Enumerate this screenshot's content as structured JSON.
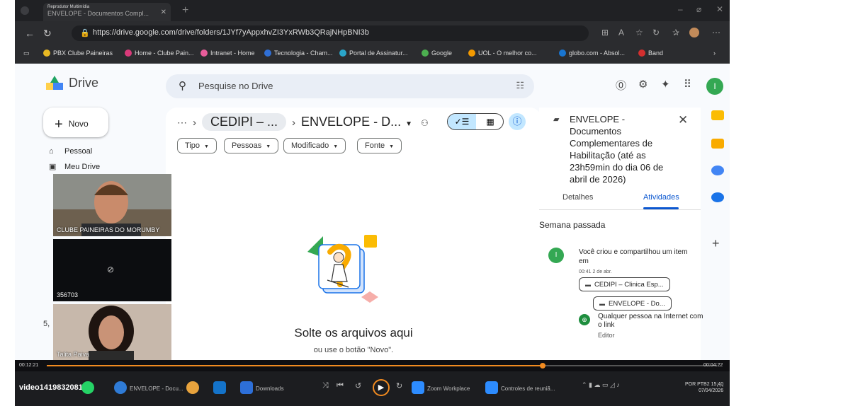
{
  "player": {
    "video_name": "video1419832081",
    "elapsed": "00:12:21",
    "remaining": "00:04:22",
    "progress_fraction": 0.74
  },
  "browser": {
    "tab_app": "Reprodutor Multimídia",
    "tab_title": "ENVELOPE - Documentos Compl...",
    "url": "https://drive.google.com/drive/folders/1JYf7yAppxhvZI3YxRWb3QRajNHpBNI3b",
    "bookmarks": [
      "PBX Clube Paineiras",
      "Home - Clube Pain...",
      "Intranet - Home",
      "Tecnologia - Cham...",
      "Portal de Assinatur...",
      "Google",
      "UOL - O melhor co...",
      "globo.com - Absol...",
      "Band"
    ]
  },
  "drive": {
    "logo": "Drive",
    "search_placeholder": "Pesquise no Drive",
    "avatar_letter": "I",
    "new_label": "Novo",
    "sidebar": [
      "Pessoal",
      "Meu Drive"
    ],
    "sidebar_partial": [
      "5,"
    ],
    "breadcrumb_prev": "CEDIPI – ...",
    "breadcrumb_current": "ENVELOPE - D...",
    "filters": [
      "Tipo",
      "Pessoas",
      "Modificado",
      "Fonte"
    ],
    "drop_title": "Solte os arquivos aqui",
    "drop_subtitle": "ou use o botão \"Novo\"."
  },
  "details": {
    "title": "ENVELOPE - Documentos Complementares de Habilitação (até as 23h59min do dia 06 de abril de 2026)",
    "tab_details": "Detalhes",
    "tab_activities": "Atividades",
    "week_label": "Semana passada",
    "activity_avatar": "I",
    "activity_text": "Você criou e compartilhou um item em",
    "activity_time": "00:41 2 de abr.",
    "folder_parent": "CEDIPI – Clinica Esp...",
    "folder_child": "ENVELOPE - Do...",
    "link_access": "Qualquer pessoa na Internet com o link",
    "link_role": "Editor"
  },
  "participants": [
    {
      "name": "CLUBE PAINEIRAS DO MORUMBY"
    },
    {
      "name": "356703"
    },
    {
      "name": "Talita Paiva"
    }
  ],
  "taskbar": {
    "items": [
      "ENVELOPE - Docu...",
      "Downloads",
      "Zoom Workplace",
      "Controles de reuniã..."
    ],
    "lang": "POR PTB2",
    "time": "15:40",
    "date": "07/04/2026"
  },
  "colors": {
    "accent": "#f28b20",
    "drive_blue": "#0b57d0",
    "selected_chip": "#c2e7ff"
  }
}
